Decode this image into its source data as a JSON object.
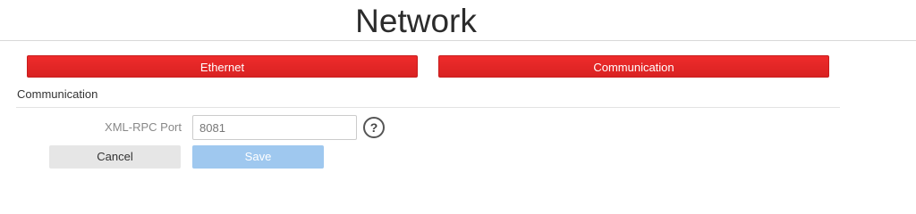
{
  "header": {
    "title": "Network"
  },
  "tabs": [
    {
      "label": "Ethernet"
    },
    {
      "label": "Communication"
    }
  ],
  "section": {
    "heading": "Communication"
  },
  "form": {
    "xmlrpc_port": {
      "label": "XML-RPC Port",
      "value": "8081",
      "help_icon": "help-circle-icon",
      "help_glyph": "?"
    }
  },
  "actions": {
    "cancel_label": "Cancel",
    "save_label": "Save"
  },
  "colors": {
    "tab_red": "#e62828",
    "save_disabled": "#9fc8ef",
    "cancel_gray": "#e6e6e6"
  }
}
